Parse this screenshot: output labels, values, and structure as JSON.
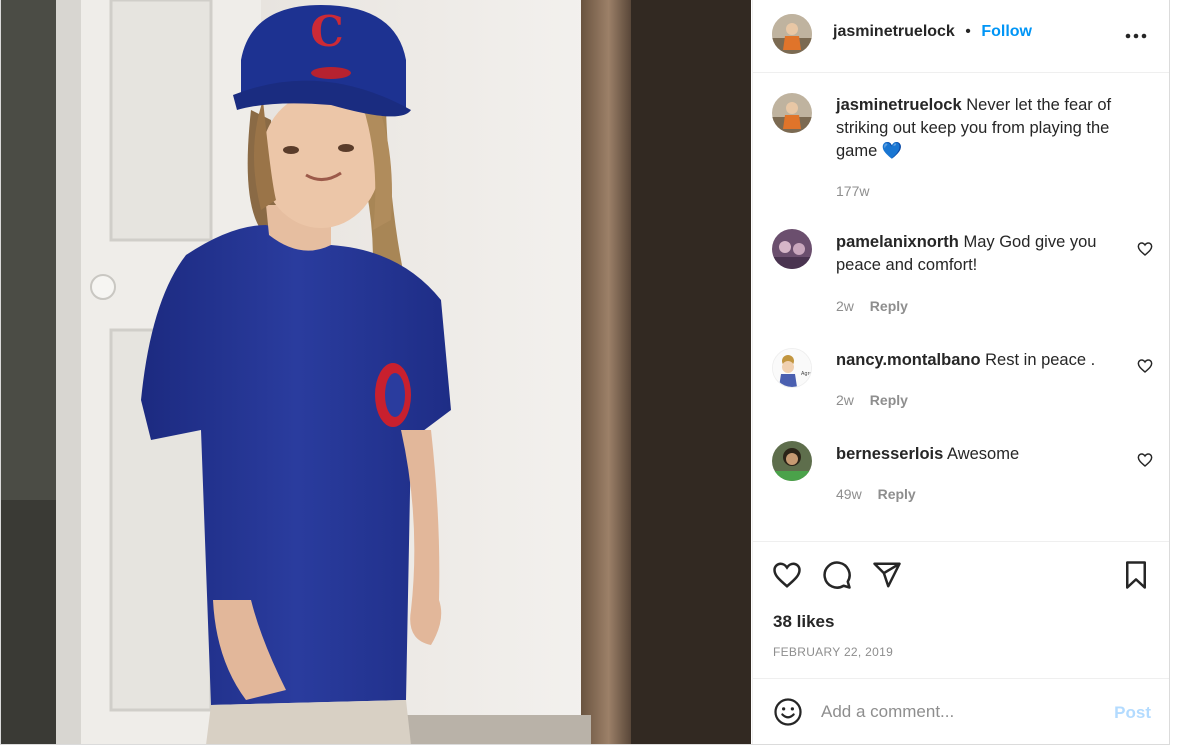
{
  "post": {
    "author": "jasminetruelock",
    "separator": "•",
    "follow_label": "Follow",
    "more_label": "•••",
    "caption": {
      "user": "jasminetruelock",
      "text": "Never let the fear of striking out keep you from playing the game",
      "emoji": "💙",
      "age": "177w"
    },
    "comments": [
      {
        "user": "pamelanixnorth",
        "text": "May God give you peace and comfort!",
        "age": "2w",
        "reply_label": "Reply"
      },
      {
        "user": "nancy.montalbano",
        "text": "Rest in peace .",
        "age": "2w",
        "reply_label": "Reply"
      },
      {
        "user": "bernesserlois",
        "text": "Awesome",
        "age": "49w",
        "reply_label": "Reply"
      }
    ],
    "likes": "38 likes",
    "date": "FEBRUARY 22, 2019",
    "add_comment_placeholder": "Add a comment...",
    "post_label": "Post"
  },
  "colors": {
    "follow": "#0095f6",
    "post_disabled": "#b3dbff",
    "muted": "#8e8e8e",
    "text": "#262626"
  },
  "icons": [
    "more-options-icon",
    "like-icon",
    "comment-icon",
    "share-icon",
    "bookmark-icon",
    "emoji-icon",
    "comment-like-icon"
  ]
}
